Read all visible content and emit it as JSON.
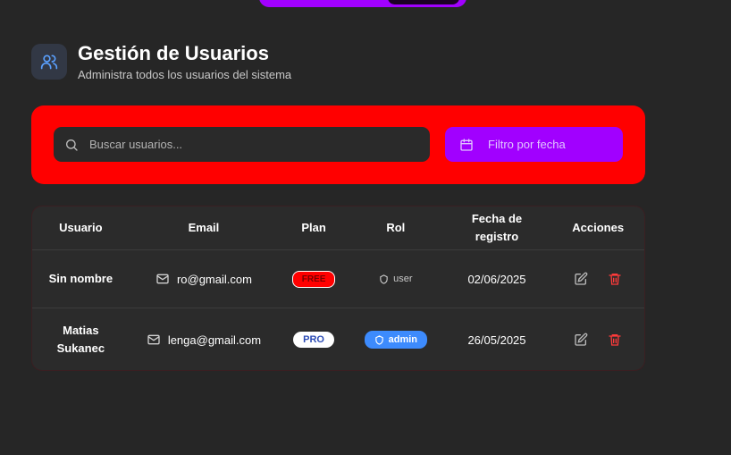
{
  "header": {
    "title": "Gestión de Usuarios",
    "subtitle": "Administra todos los usuarios del sistema",
    "icon": "users-icon"
  },
  "filters": {
    "search_placeholder": "Buscar usuarios...",
    "date_filter_label": "Filtro por fecha",
    "panel_color": "#ff0000",
    "date_filter_color": "#a100ff"
  },
  "table": {
    "headers": {
      "user": "Usuario",
      "email": "Email",
      "plan": "Plan",
      "role": "Rol",
      "date_line1": "Fecha de",
      "date_line2": "registro",
      "actions": "Acciones"
    },
    "rows": [
      {
        "name_line1": "Sin nombre",
        "name_line2": "",
        "email": "ro@gmail.com",
        "plan": "FREE",
        "role": "user",
        "date": "02/06/2025"
      },
      {
        "name_line1": "Matias",
        "name_line2": "Sukanec",
        "email": "lenga@gmail.com",
        "plan": "PRO",
        "role": "admin",
        "date": "26/05/2025"
      }
    ]
  }
}
